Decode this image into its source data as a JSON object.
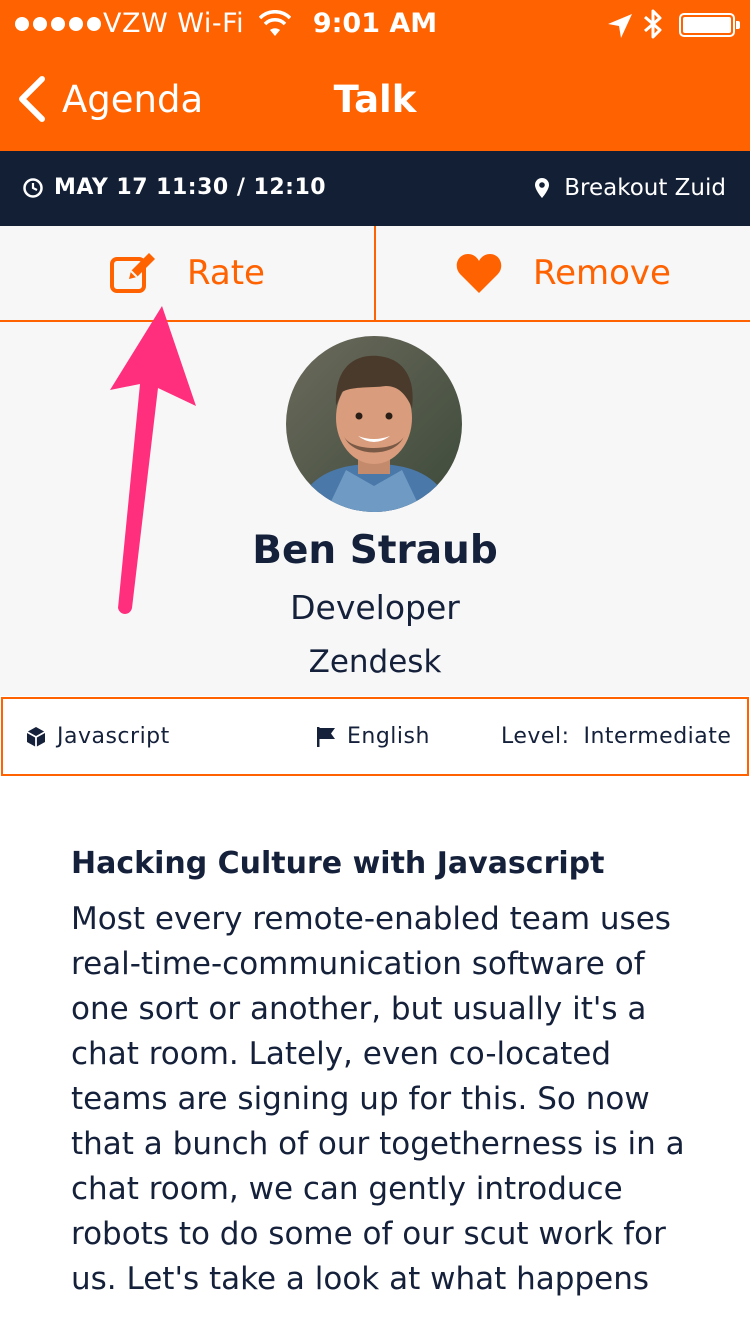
{
  "status_bar": {
    "carrier": "VZW Wi-Fi",
    "time": "9:01 AM"
  },
  "nav": {
    "back_label": "Agenda",
    "title": "Talk"
  },
  "session": {
    "datetime": "MAY 17 11:30 / 12:10",
    "room": "Breakout Zuid"
  },
  "actions": {
    "rate_label": "Rate",
    "remove_label": "Remove"
  },
  "speaker": {
    "name": "Ben Straub",
    "role": "Developer",
    "company": "Zendesk"
  },
  "meta": {
    "track": "Javascript",
    "language": "English",
    "level_label": "Level:",
    "level_value": "Intermediate"
  },
  "talk": {
    "title": "Hacking Culture with Javascript",
    "description": "Most every remote-enabled team uses real-time-communication software of one sort or another, but usually it's a chat room. Lately, even co-located teams are signing up for this. So now that a bunch of our togetherness is in a chat room, we can gently introduce robots to do some of our scut work for us. Let's take a look at what happens"
  },
  "colors": {
    "accent": "#ff6200",
    "dark": "#131f35",
    "annotation": "#ff2f7e"
  }
}
